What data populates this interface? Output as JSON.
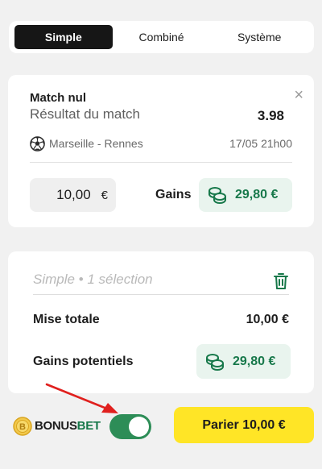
{
  "tabs": [
    {
      "label": "Simple",
      "active": true
    },
    {
      "label": "Combiné",
      "active": false
    },
    {
      "label": "Système",
      "active": false
    }
  ],
  "selection": {
    "title": "Match nul",
    "market": "Résultat du match",
    "odds": "3.98",
    "sport_icon": "soccer-ball-icon",
    "match": "Marseille - Rennes",
    "date": "17/05 21h00",
    "close_glyph": "×"
  },
  "stake": {
    "value": "10,00",
    "currency": "€"
  },
  "gains": {
    "label": "Gains",
    "value": "29,80 €",
    "icon": "coins-icon"
  },
  "summary": {
    "placeholder": "Simple • 1 sélection",
    "mise_label": "Mise totale",
    "mise_value": "10,00 €",
    "potential_label": "Gains potentiels",
    "potential_value": "29,80 €"
  },
  "bonus": {
    "brand_part1": "BONUS",
    "brand_part2": "BET",
    "enabled": true
  },
  "bet_button": {
    "label": "Parier 10,00 €"
  },
  "colors": {
    "accent_yellow": "#ffe526",
    "gain_green": "#17784a",
    "toggle_green": "#2d8d57",
    "arrow_red": "#e0201e"
  }
}
